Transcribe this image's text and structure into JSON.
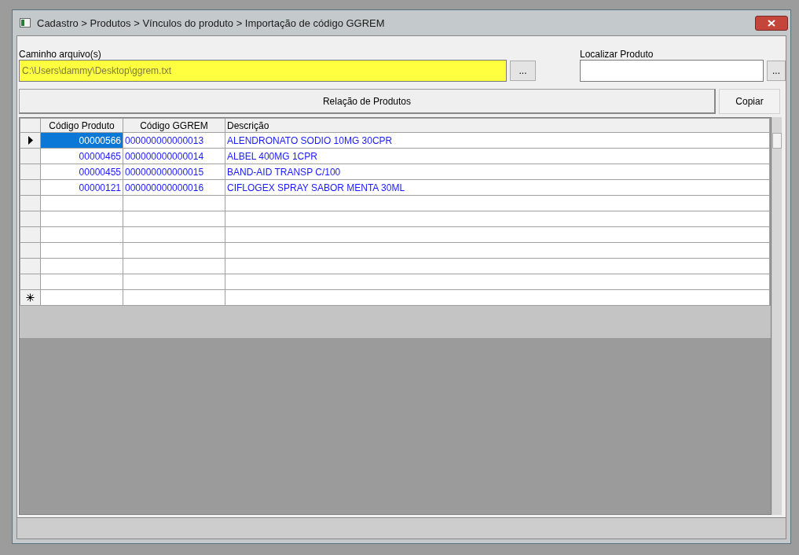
{
  "window": {
    "title": "Cadastro > Produtos > Vínculos do produto > Importação de código GGREM"
  },
  "file_path": {
    "label": "Caminho arquivo(s)",
    "value": "C:\\Users\\dammy\\Desktop\\ggrem.txt",
    "browse_button": "..."
  },
  "find_product": {
    "label": "Localizar Produto",
    "browse_button": "..."
  },
  "product_list_button": "Relação de Produtos",
  "copy_button": "Copiar",
  "table": {
    "columns": [
      "Código Produto",
      "Código GGREM",
      "Descrição"
    ],
    "rows": [
      {
        "kind": "data",
        "selected": true,
        "cells": [
          "00000566",
          "000000000000013",
          "ALENDRONATO SODIO 10MG 30CPR"
        ]
      },
      {
        "kind": "data",
        "selected": false,
        "cells": [
          "00000465",
          "000000000000014",
          "ALBEL 400MG 1CPR"
        ]
      },
      {
        "kind": "data",
        "selected": false,
        "cells": [
          "00000455",
          "000000000000015",
          "BAND-AID TRANSP C/100"
        ]
      },
      {
        "kind": "data",
        "selected": false,
        "cells": [
          "00000121",
          "000000000000016",
          "CIFLOGEX SPRAY SABOR MENTA 30ML"
        ]
      },
      {
        "kind": "empty"
      },
      {
        "kind": "empty"
      },
      {
        "kind": "empty"
      },
      {
        "kind": "empty"
      },
      {
        "kind": "empty"
      },
      {
        "kind": "empty"
      },
      {
        "kind": "new"
      }
    ]
  }
}
